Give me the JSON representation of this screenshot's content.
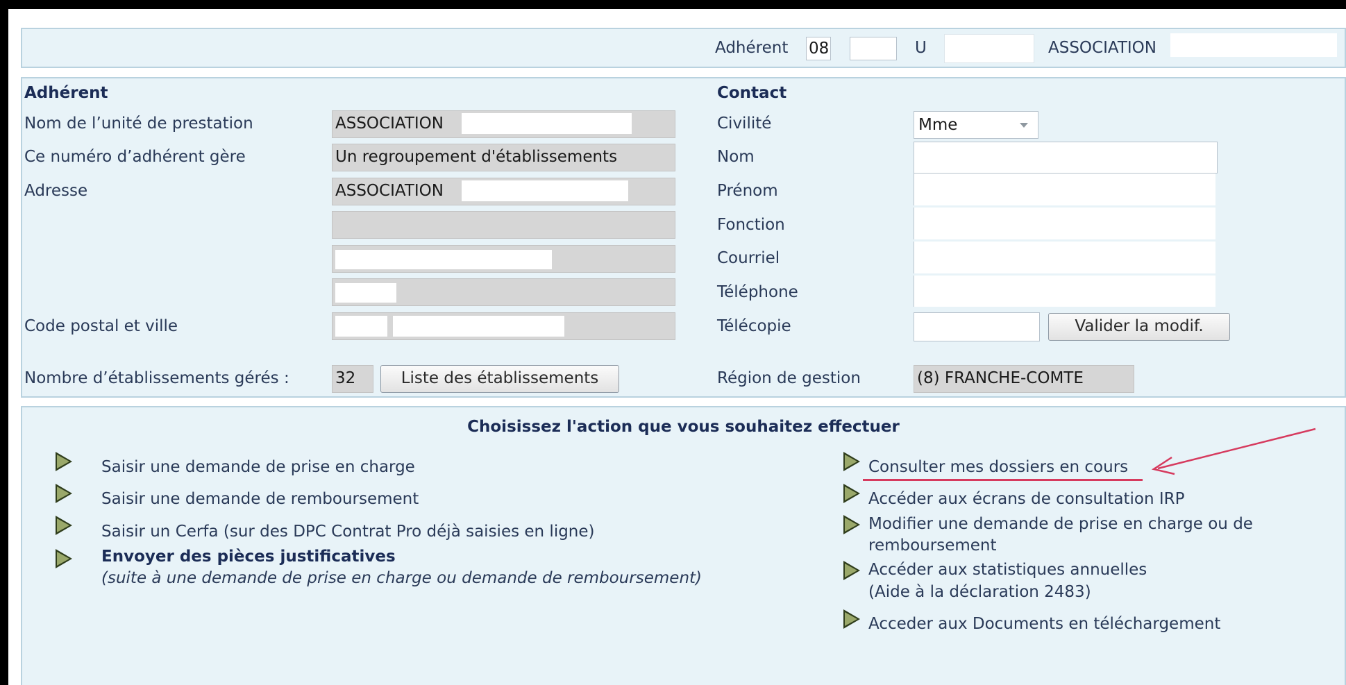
{
  "topbar": {
    "adherent_label": "Adhérent",
    "adherent_code": "08",
    "adherent_num": "",
    "u_label": "U",
    "u_value": "",
    "association": "ASSOCIATION"
  },
  "adherent_section": {
    "title": "Adhérent",
    "nom_label": "Nom de l’unité de prestation",
    "nom_value": "ASSOCIATION",
    "gere_label": "Ce numéro d’adhérent gère",
    "gere_value": "Un regroupement d'établissements",
    "adresse_label": "Adresse",
    "adresse_value": "ASSOCIATION",
    "cp_label": "Code postal et ville",
    "nb_label": "Nombre d’établissements gérés :",
    "nb_value": "32",
    "liste_button": "Liste des établissements"
  },
  "contact_section": {
    "title": "Contact",
    "civilite_label": "Civilité",
    "civilite_value": "Mme",
    "nom_label": "Nom",
    "prenom_label": "Prénom",
    "fonction_label": "Fonction",
    "courriel_label": "Courriel",
    "telephone_label": "Téléphone",
    "telecopie_label": "Télécopie",
    "valider_button": "Valider la modif.",
    "region_label": "Région de gestion",
    "region_value": "(8) FRANCHE-COMTE"
  },
  "actions": {
    "title": "Choisissez l'action que vous souhaitez effectuer",
    "left": [
      "Saisir une demande de prise en charge",
      "Saisir une demande de remboursement",
      "Saisir un Cerfa (sur des DPC Contrat Pro déjà saisies en ligne)"
    ],
    "envoyer_title": "Envoyer des pièces justificatives",
    "envoyer_sub": "(suite à une demande de prise en charge ou demande de remboursement)",
    "right": {
      "consulter": "Consulter mes dossiers en cours",
      "irp": "Accéder aux écrans de consultation IRP",
      "modifier_1": "Modifier une demande de prise en charge ou de",
      "modifier_2": "remboursement",
      "stats_1": "Accéder aux statistiques annuelles",
      "stats_2": "(Aide à la déclaration 2483)",
      "documents": "Acceder aux Documents en téléchargement"
    }
  },
  "colors": {
    "annotation": "#d63a5e",
    "panel_bg": "#e8f3f8",
    "header_text": "#1b2c56"
  }
}
